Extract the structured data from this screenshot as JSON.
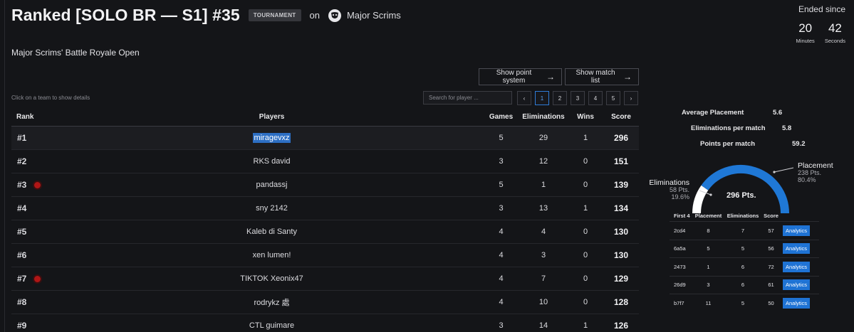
{
  "header": {
    "title": "Ranked [SOLO BR — S1] #35",
    "badge": "TOURNAMENT",
    "on_label": "on",
    "org_name": "Major Scrims",
    "subtitle": "Major Scrims' Battle Royale Open"
  },
  "ended": {
    "label": "Ended since",
    "minutes": "20",
    "minutes_label": "Minutes",
    "seconds": "42",
    "seconds_label": "Seconds"
  },
  "actions": {
    "point_system": "Show point system",
    "match_list": "Show match list"
  },
  "table_hint": "Click on a team to show details",
  "search": {
    "placeholder": "Search for player ..."
  },
  "pagination": {
    "prev": "‹",
    "next": "›",
    "pages": [
      "1",
      "2",
      "3",
      "4",
      "5"
    ],
    "current": "1"
  },
  "columns": {
    "rank": "Rank",
    "players": "Players",
    "games": "Games",
    "eliminations": "Eliminations",
    "wins": "Wins",
    "score": "Score"
  },
  "rows": [
    {
      "rank": "#1",
      "player": "miragevxz",
      "games": "5",
      "eliminations": "29",
      "wins": "1",
      "score": "296",
      "live": false
    },
    {
      "rank": "#2",
      "player": "RKS david",
      "games": "3",
      "eliminations": "12",
      "wins": "0",
      "score": "151",
      "live": false
    },
    {
      "rank": "#3",
      "player": "pandassj",
      "games": "5",
      "eliminations": "1",
      "wins": "0",
      "score": "139",
      "live": true
    },
    {
      "rank": "#4",
      "player": "sny 2142",
      "games": "3",
      "eliminations": "13",
      "wins": "1",
      "score": "134",
      "live": false
    },
    {
      "rank": "#5",
      "player": "Kaleb di Santy",
      "games": "4",
      "eliminations": "4",
      "wins": "0",
      "score": "130",
      "live": false
    },
    {
      "rank": "#6",
      "player": "xen lumen!",
      "games": "4",
      "eliminations": "3",
      "wins": "0",
      "score": "130",
      "live": false
    },
    {
      "rank": "#7",
      "player": "TIKTOK Xeonix47",
      "games": "4",
      "eliminations": "7",
      "wins": "0",
      "score": "129",
      "live": true
    },
    {
      "rank": "#8",
      "player": "rodrykz 處",
      "games": "4",
      "eliminations": "10",
      "wins": "0",
      "score": "128",
      "live": false
    },
    {
      "rank": "#9",
      "player": "CTL guimare",
      "games": "3",
      "eliminations": "14",
      "wins": "1",
      "score": "126",
      "live": false
    }
  ],
  "stats": {
    "avg_placement_label": "Average Placement",
    "avg_placement": "5.6",
    "elims_per_match_label": "Eliminations per match",
    "elims_per_match": "5.8",
    "points_per_match_label": "Points per match",
    "points_per_match": "59.2"
  },
  "gauge": {
    "total": "296 Pts.",
    "placement_label": "Placement",
    "placement_pts": "238 Pts.",
    "placement_pct": "80.4%",
    "placement_fraction": 0.804,
    "elims_label": "Eliminations",
    "elims_pts": "58 Pts.",
    "elims_pct": "19.6%",
    "elims_fraction": 0.196,
    "colors": {
      "placement": "#1f78d6",
      "eliminations": "#ffffff"
    }
  },
  "matches": {
    "columns": {
      "first": "First 4",
      "placement": "Placement",
      "eliminations": "Eliminations",
      "score": "Score"
    },
    "action_label": "Analytics",
    "rows": [
      {
        "first": "2cd4",
        "placement": "8",
        "eliminations": "7",
        "score": "57"
      },
      {
        "first": "6a5a",
        "placement": "5",
        "eliminations": "5",
        "score": "56"
      },
      {
        "first": "2473",
        "placement": "1",
        "eliminations": "6",
        "score": "72"
      },
      {
        "first": "26d9",
        "placement": "3",
        "eliminations": "6",
        "score": "61"
      },
      {
        "first": "b7f7",
        "placement": "11",
        "eliminations": "5",
        "score": "50"
      }
    ]
  },
  "icons": {
    "org_logo": "mask-logo-icon",
    "arrow": "arrow-right-icon",
    "live": "live-dot-icon"
  }
}
